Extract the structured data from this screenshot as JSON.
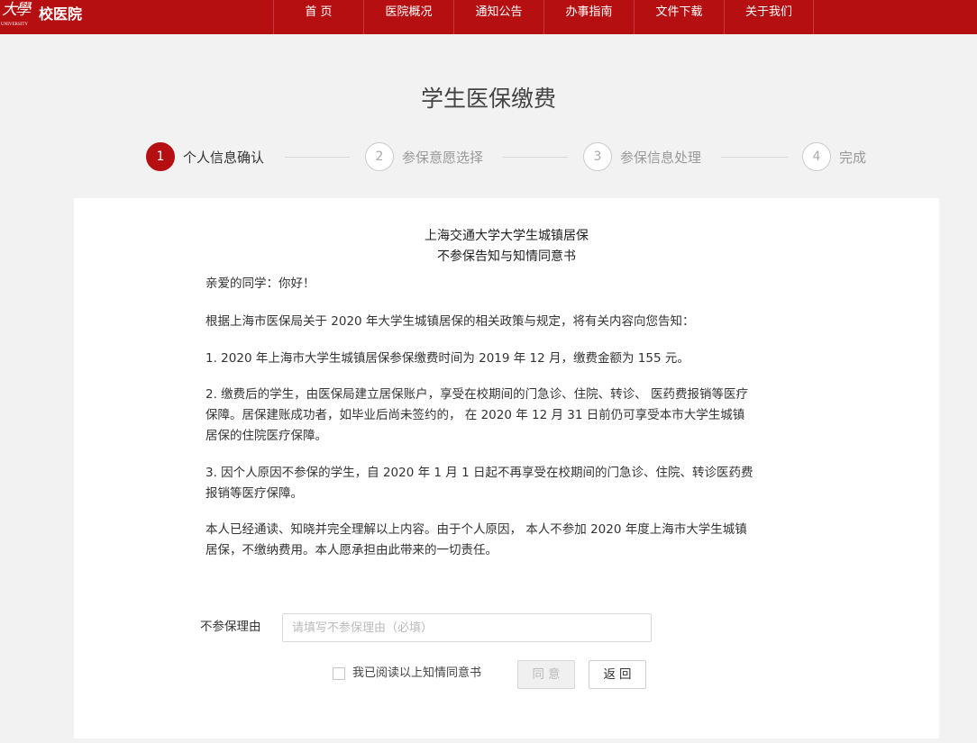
{
  "header": {
    "logo_glyph": "大學",
    "logo_sub": "UNIVERSITY",
    "site_name": "校医院",
    "nav": [
      "首 页",
      "医院概况",
      "通知公告",
      "办事指南",
      "文件下载",
      "关于我们"
    ]
  },
  "page_title": "学生医保缴费",
  "steps": [
    {
      "num": "1",
      "label": "个人信息确认",
      "active": true
    },
    {
      "num": "2",
      "label": "参保意愿选择",
      "active": false
    },
    {
      "num": "3",
      "label": "参保信息处理",
      "active": false
    },
    {
      "num": "4",
      "label": "完成",
      "active": false
    }
  ],
  "document": {
    "title_line1": "上海交通大学大学生城镇居保",
    "title_line2": "不参保告知与知情同意书",
    "greeting": "亲爱的同学：你好！",
    "intro": "根据上海市医保局关于 2020 年大学生城镇居保的相关政策与规定，将有关内容向您告知：",
    "item1": "1. 2020 年上海市大学生城镇居保参保缴费时间为 2019 年 12 月，缴费金额为 155 元。",
    "item2": "2. 缴费后的学生，由医保局建立居保账户，享受在校期间的门急诊、住院、转诊、 医药费报销等医疗保障。居保建账成功者，如毕业后尚未签约的， 在 2020 年 12 月 31 日前仍可享受本市大学生城镇居保的住院医疗保障。",
    "item3": "3. 因个人原因不参保的学生，自 2020 年 1 月 1 日起不再享受在校期间的门急诊、住院、转诊医药费报销等医疗保障。",
    "declaration": "本人已经通读、知晓并完全理解以上内容。由于个人原因， 本人不参加 2020 年度上海市大学生城镇居保，不缴纳费用。本人愿承担由此带来的一切责任。"
  },
  "form": {
    "reason_label": "不参保理由",
    "reason_placeholder": "请填写不参保理由（必填）",
    "reason_value": "",
    "agree_label": "我已阅读以上知情同意书",
    "agree_checked": false,
    "agree_button": "同意",
    "back_button": "返回"
  },
  "colors": {
    "brand": "#b50f12",
    "page_bg": "#f2f2f2"
  }
}
